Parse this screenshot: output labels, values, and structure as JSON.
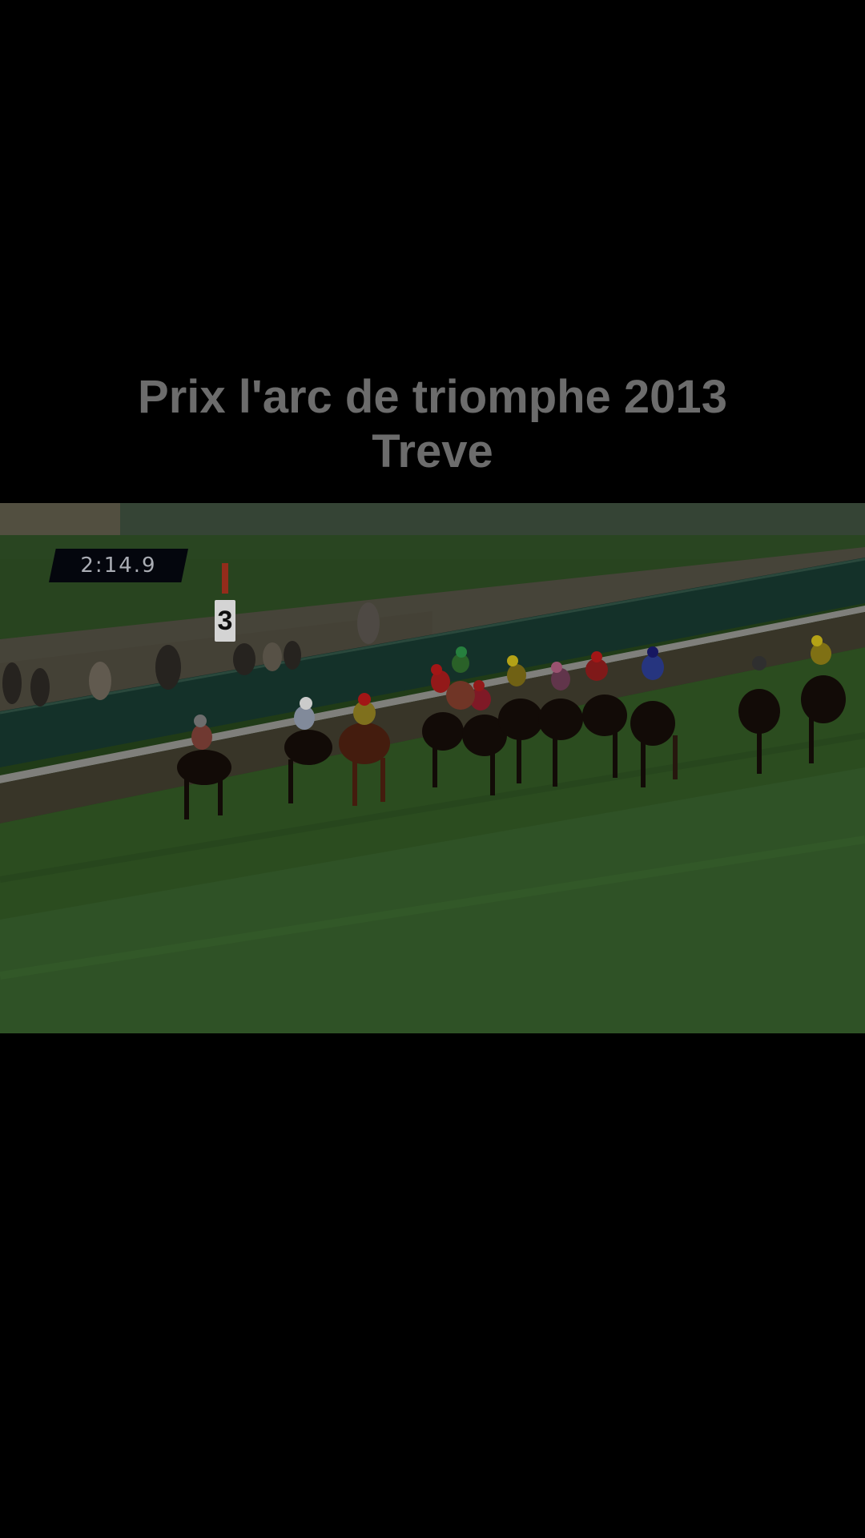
{
  "caption": {
    "line1": "Prix l'arc de triomphe 2013",
    "line2": "Treve"
  },
  "video": {
    "timer": "2:14.9",
    "furlong_marker": "3"
  },
  "colors": {
    "background": "#000000",
    "caption_text": "#6c6c6c",
    "turf": "#2f5322",
    "rail": "#16362d"
  }
}
